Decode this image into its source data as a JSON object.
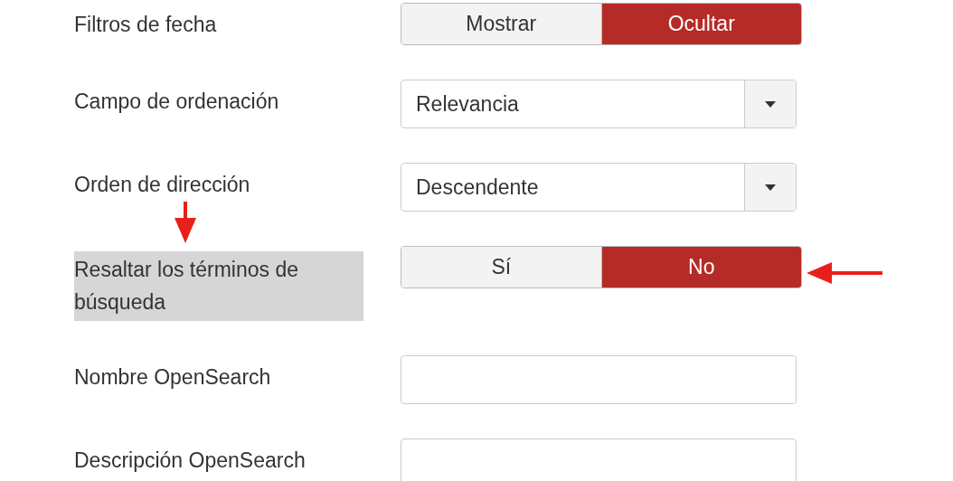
{
  "fields": [
    {
      "kind": "toggle",
      "label": "Filtros de fecha",
      "highlighted": false,
      "options": [
        {
          "label": "Mostrar",
          "selected": false
        },
        {
          "label": "Ocultar",
          "selected": true
        }
      ]
    },
    {
      "kind": "select",
      "label": "Campo de ordenación",
      "highlighted": false,
      "value": "Relevancia"
    },
    {
      "kind": "select",
      "label": "Orden de dirección",
      "highlighted": false,
      "value": "Descendente"
    },
    {
      "kind": "toggle",
      "label": "Resaltar los términos de búsqueda",
      "highlighted": true,
      "options": [
        {
          "label": "Sí",
          "selected": false
        },
        {
          "label": "No",
          "selected": true
        }
      ]
    },
    {
      "kind": "text",
      "label": "Nombre OpenSearch",
      "highlighted": false
    },
    {
      "kind": "text",
      "label": "Descripción OpenSearch",
      "highlighted": false
    }
  ]
}
